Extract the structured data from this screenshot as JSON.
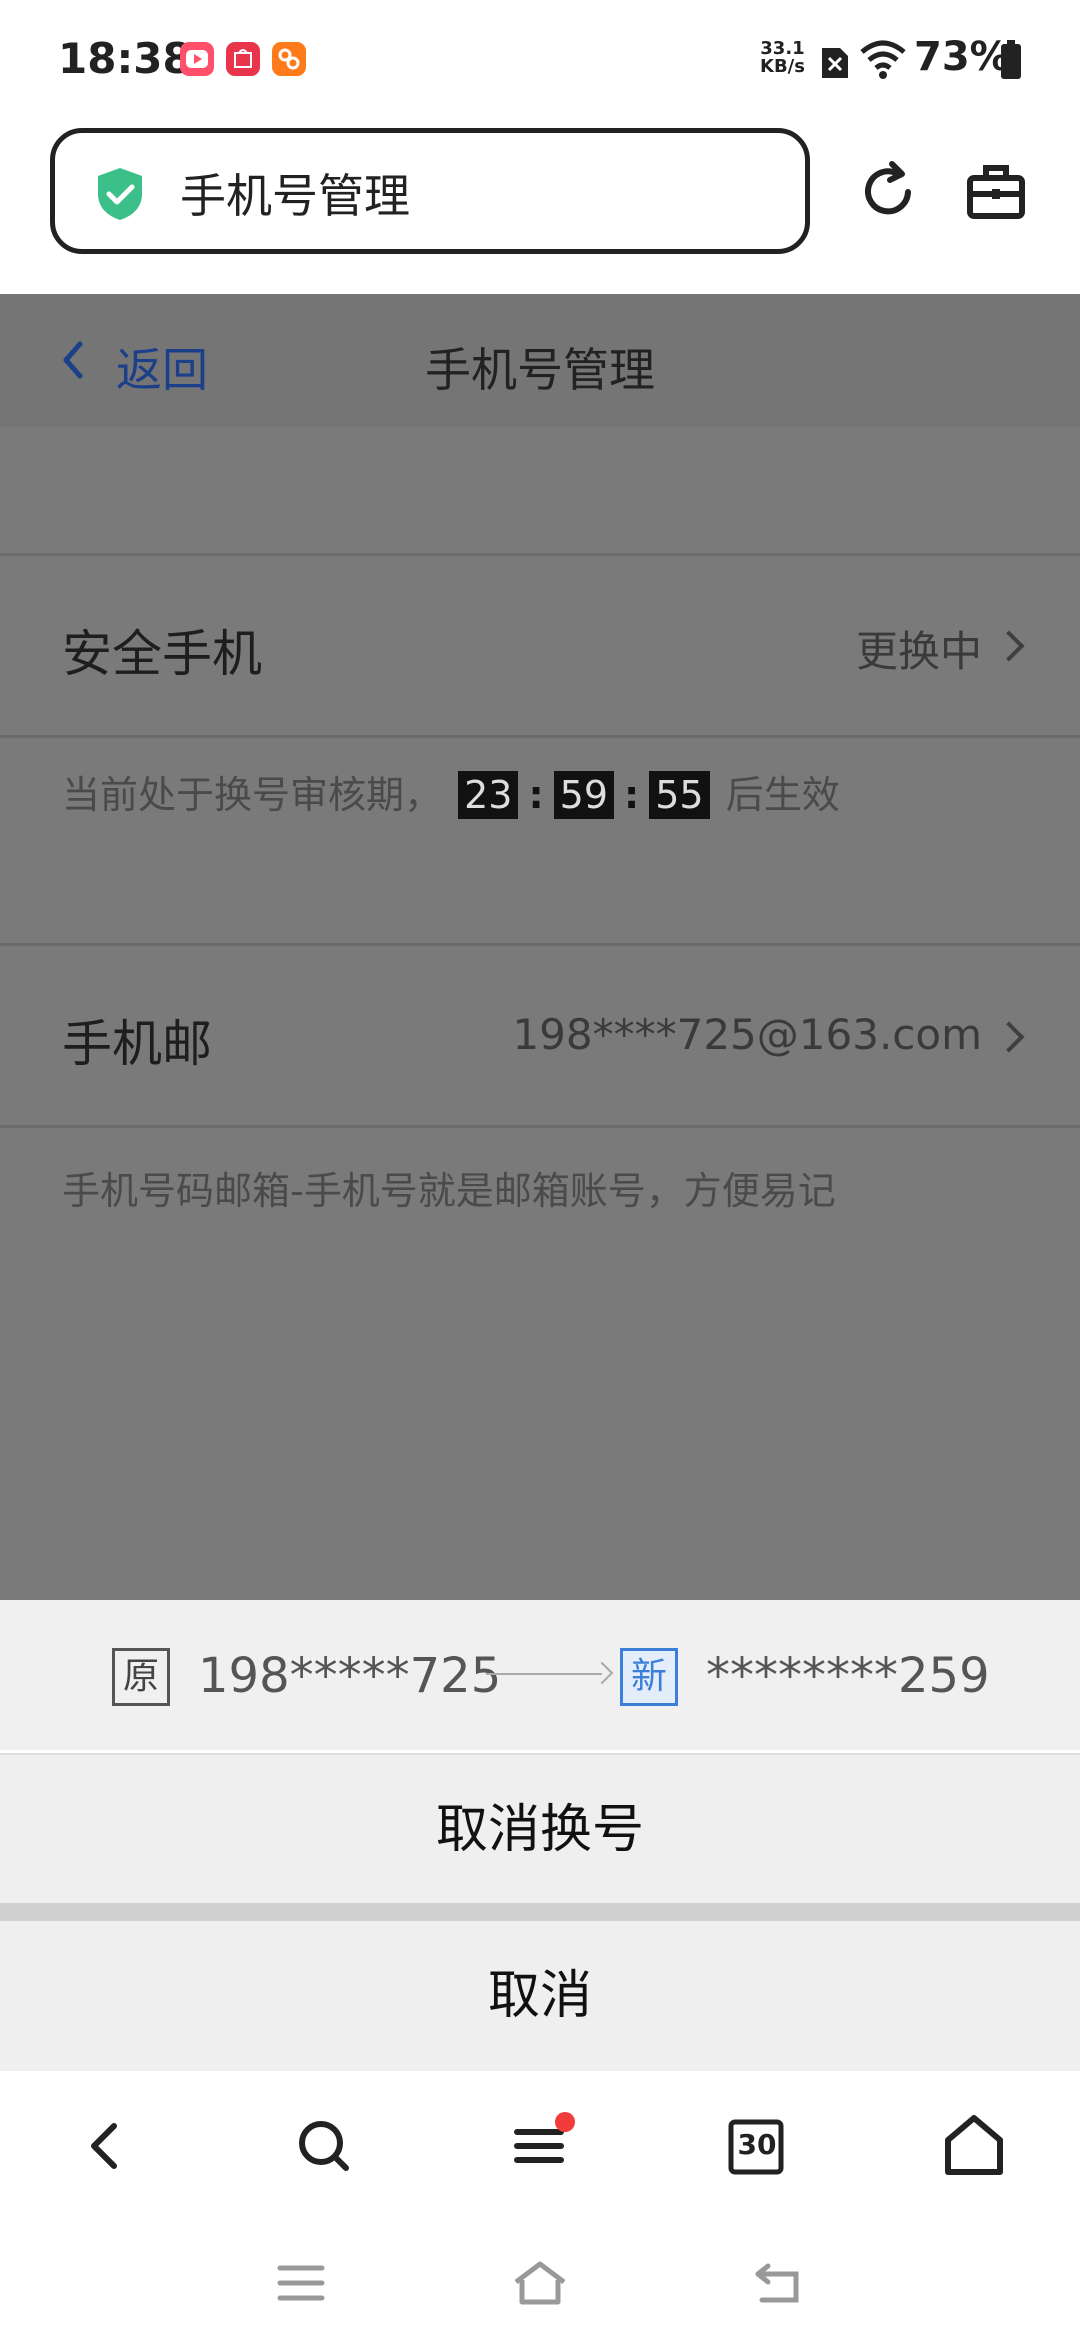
{
  "status_bar": {
    "time": "18:38",
    "net_speed_value": "33.1",
    "net_speed_unit": "KB/s",
    "battery": "73%",
    "icons": [
      "video-app-icon",
      "huawei-store-icon",
      "orange-app-icon",
      "no-sim-icon",
      "wifi-icon",
      "battery-icon"
    ]
  },
  "browser": {
    "address_title": "手机号管理",
    "icons": [
      "shield-check-icon",
      "refresh-icon",
      "toolbox-icon"
    ]
  },
  "page": {
    "back_label": "返回",
    "title": "手机号管理",
    "secure_phone": {
      "label": "安全手机",
      "value": "更换中"
    },
    "review": {
      "prefix": "当前处于换号审核期，",
      "hours": "23",
      "minutes": "59",
      "seconds": "55",
      "suffix": "后生效"
    },
    "phone_mail": {
      "label": "手机邮",
      "value": "198****725@163.com"
    },
    "phone_mail_desc": "手机号码邮箱-手机号就是邮箱账号，方便易记"
  },
  "sheet": {
    "old_tag": "原",
    "old_number": "198*****725",
    "new_tag": "新",
    "new_number": "********259",
    "cancel_change": "取消换号",
    "cancel": "取消"
  },
  "toolbar": {
    "tab_count": "30",
    "icons": [
      "back-icon",
      "search-icon",
      "menu-icon",
      "tabs-icon",
      "home-icon"
    ]
  },
  "colors": {
    "accent_blue": "#3b7fd9",
    "shield_green": "#3cc08a",
    "overlay_gray": "#7a7a7a",
    "badge_red": "#f23b3b"
  }
}
